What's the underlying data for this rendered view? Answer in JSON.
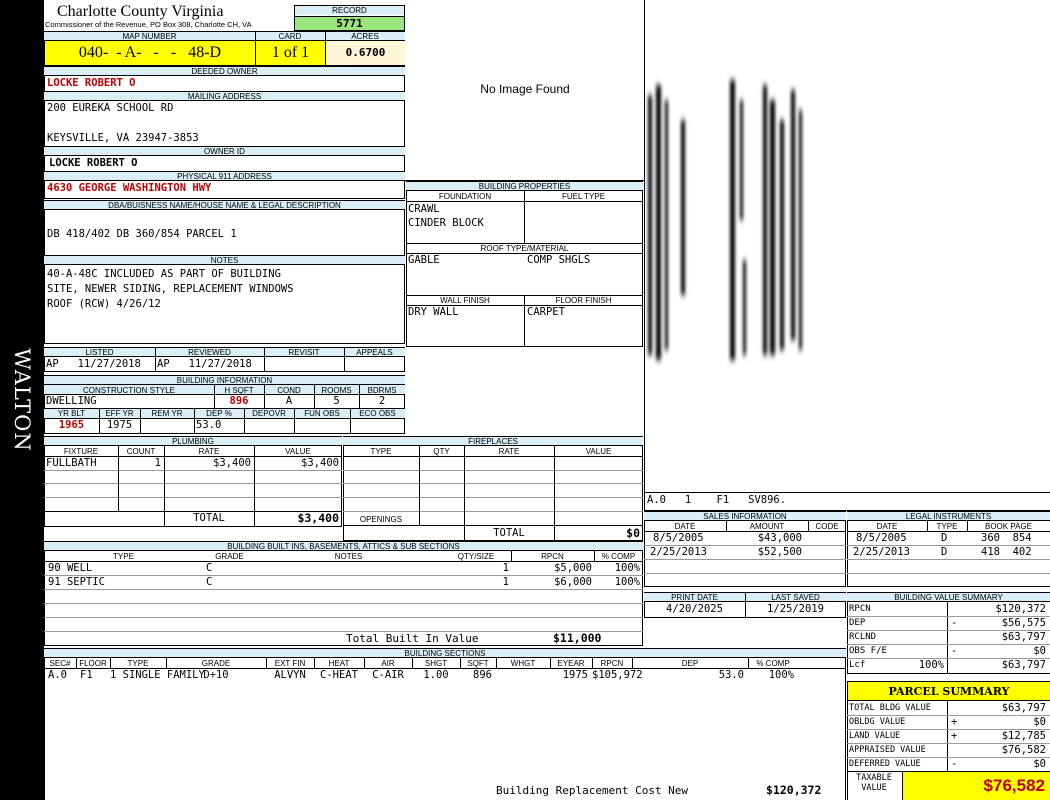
{
  "district": "WALTON",
  "header": {
    "county": "Charlotte County Virginia",
    "subtitle": "Commissioner of the Revenue, PO Box 308, Charlotte CH, VA",
    "record_label": "RECORD",
    "record": "5771",
    "map_label": "MAP NUMBER",
    "map_number": "040-  - A-   -   -   48-D",
    "card_label": "CARD",
    "card": "1 of 1",
    "acres_label": "ACRES",
    "acres": "0.6700"
  },
  "owner": {
    "deeded_label": "DEEDED OWNER",
    "deeded": "LOCKE ROBERT O",
    "mailing_label": "MAILING ADDRESS",
    "mail1": "200 EUREKA SCHOOL RD",
    "mail2": "KEYSVILLE, VA 23947-3853",
    "ownerid_label": "OWNER ID",
    "ownerid": "LOCKE ROBERT O",
    "physical_label": "PHYSICAL 911 ADDRESS",
    "physical": "4630 GEORGE WASHINGTON HWY",
    "dba_label": "DBA/BUISNESS NAME/HOUSE NAME & LEGAL DESCRIPTION",
    "dba": "DB 418/402 DB 360/854 PARCEL 1"
  },
  "notes": {
    "label": "NOTES",
    "lines": [
      "40-A-48C INCLUDED AS PART OF BUILDING",
      "SITE, NEWER SIDING, REPLACEMENT WINDOWS",
      "ROOF (RCW) 4/26/12"
    ]
  },
  "image": {
    "text": "No Image Found"
  },
  "building_props": {
    "title": "BUILDING PROPERTIES",
    "foundation_label": "FOUNDATION",
    "fuel_label": "FUEL TYPE",
    "foundation1": "CRAWL",
    "foundation2": "CINDER BLOCK",
    "roof_label": "ROOF TYPE/MATERIAL",
    "roof_type": "GABLE",
    "roof_material": "COMP SHGLS",
    "wall_label": "WALL FINISH",
    "floor_label": "FLOOR FINISH",
    "wall": "DRY WALL",
    "floor": "CARPET"
  },
  "sketch": {
    "label": "A.0   1    F1   SV896."
  },
  "dates": {
    "listed_label": "LISTED",
    "reviewed_label": "REVIEWED",
    "revisit_label": "REVISIT",
    "appeals_label": "APPEALS",
    "listed": "AP   11/27/2018",
    "reviewed": "AP   11/27/2018"
  },
  "bldg_info": {
    "title": "BUILDING INFORMATION",
    "cs_label": "CONSTRUCTION STYLE",
    "hsqft_label": "H SQFT",
    "cond_label": "COND",
    "rooms_label": "ROOMS",
    "bdrms_label": "BDRMS",
    "style": "DWELLING",
    "hsqft": "896",
    "cond": "A",
    "rooms": "5",
    "bdrms": "2",
    "yrblt_label": "YR BLT",
    "effyr_label": "EFF YR",
    "remyr_label": "REM YR",
    "dep_label": "DEP %",
    "depovr_label": "DEPOVR",
    "funobs_label": "FUN OBS",
    "ecoobs_label": "ECO OBS",
    "yrblt": "1965",
    "effyr": "1975",
    "dep": "53.0"
  },
  "plumbing": {
    "title": "PLUMBING",
    "cols": [
      "FIXTURE",
      "COUNT",
      "RATE",
      "VALUE"
    ],
    "row": {
      "fixture": "FULLBATH",
      "count": "1",
      "rate": "$3,400",
      "value": "$3,400"
    },
    "total_label": "TOTAL",
    "total": "$3,400"
  },
  "fireplaces": {
    "title": "FIREPLACES",
    "cols": [
      "TYPE",
      "QTY",
      "RATE",
      "VALUE"
    ],
    "openings_label": "OPENINGS",
    "total_label": "TOTAL",
    "total": "$0"
  },
  "builtins": {
    "title": "BUILDING BUILT INS, BASEMENTS, ATTICS & SUB SECTIONS",
    "cols": [
      "TYPE",
      "GRADE",
      "NOTES",
      "QTY/SIZE",
      "RPCN",
      "% COMP"
    ],
    "rows": [
      {
        "type": "90 WELL",
        "grade": "C",
        "qty": "1",
        "rpcn": "$5,000",
        "comp": "100%"
      },
      {
        "type": "91 SEPTIC",
        "grade": "C",
        "qty": "1",
        "rpcn": "$6,000",
        "comp": "100%"
      }
    ],
    "total_label": "Total Built In Value",
    "total": "$11,000"
  },
  "sales": {
    "title": "SALES INFORMATION",
    "cols": [
      "DATE",
      "AMOUNT",
      "CODE"
    ],
    "rows": [
      {
        "date": "8/5/2005",
        "amount": "$43,000"
      },
      {
        "date": "2/25/2013",
        "amount": "$52,500"
      }
    ]
  },
  "legal": {
    "title": "LEGAL INSTRUMENTS",
    "cols": [
      "DATE",
      "TYPE",
      "BOOK PAGE"
    ],
    "rows": [
      {
        "date": "8/5/2005",
        "type": "D",
        "book": "360  854"
      },
      {
        "date": "2/25/2013",
        "type": "D",
        "book": "418  402"
      }
    ]
  },
  "print": {
    "print_label": "PRINT DATE",
    "saved_label": "LAST SAVED",
    "print_date": "4/20/2025",
    "last_saved": "1/25/2019"
  },
  "value_summary": {
    "title": "BUILDING VALUE SUMMARY",
    "rpcn_label": "RPCN",
    "rpcn": "$120,372",
    "dep_label": "DEP",
    "dep_sign": "-",
    "dep": "$56,575",
    "rclnd_label": "RCLND",
    "rclnd": "$63,797",
    "obs_label": "OBS F/E",
    "obs_sign": "-",
    "obs": "$0",
    "lcf_label": "Lcf",
    "lcf_pct": "100%",
    "lcf": "$63,797"
  },
  "sections": {
    "title": "BUILDING SECTIONS",
    "cols": [
      "SEC#",
      "FLOOR",
      "TYPE",
      "GRADE",
      "EXT FIN",
      "HEAT",
      "AIR",
      "SHGT",
      "SQFT",
      "WHGT",
      "EYEAR",
      "RPCN",
      "DEP",
      "% COMP"
    ],
    "row": [
      "A.0",
      "F1",
      "1 SINGLE FAMILY",
      "D+10",
      "ALVYN",
      "C-HEAT",
      "C-AIR",
      "1.00",
      "896",
      "",
      "1975",
      "$105,972",
      "53.0",
      "100%"
    ],
    "replacement_label": "Building Replacement Cost New",
    "replacement": "$120,372"
  },
  "parcel": {
    "title": "PARCEL SUMMARY",
    "bldg_label": "TOTAL BLDG VALUE",
    "bldg": "$63,797",
    "obldg_label": "OBLDG VALUE",
    "obldg_sign": "+",
    "obldg": "$0",
    "land_label": "LAND VALUE",
    "land_sign": "+",
    "land": "$12,785",
    "appraised_label": "APPRAISED VALUE",
    "appraised": "$76,582",
    "deferred_label": "DEFERRED VALUE",
    "deferred_sign": "-",
    "deferred": "$0",
    "taxable_label1": "TAXABLE",
    "taxable_label2": "VALUE",
    "taxable": "$76,582"
  }
}
